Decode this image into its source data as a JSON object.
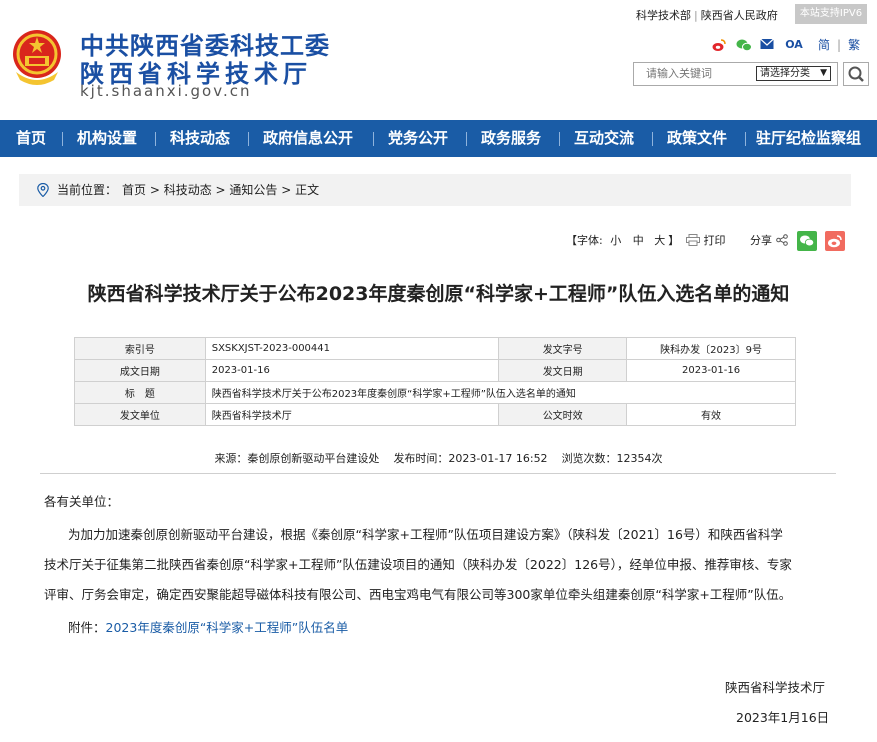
{
  "header": {
    "org_name_line1": "中共陕西省委科技工委",
    "org_name_line2": "陕西省科学技术厅",
    "domain": "kjt.shaanxi.gov.cn",
    "top_links": [
      "科学技术部",
      "陕西省人民政府"
    ],
    "ipv6_badge": "本站支持IPV6",
    "social": {
      "oa": "OA",
      "simplified": "简",
      "traditional": "繁"
    },
    "search": {
      "placeholder": "请输入关键词",
      "category_label": "请选择分类"
    }
  },
  "nav": {
    "items": [
      "首页",
      "机构设置",
      "科技动态",
      "政府信息公开",
      "党务公开",
      "政务服务",
      "互动交流",
      "政策文件",
      "驻厅纪检监察组"
    ]
  },
  "breadcrumb": {
    "label": "当前位置：",
    "path": [
      "首页",
      "科技动态",
      "通知公告",
      "正文"
    ]
  },
  "tools": {
    "font_prefix": "【字体:",
    "font_small": "小",
    "font_medium": "中",
    "font_large": "大",
    "font_suffix": "】",
    "print": "打印",
    "share": "分享"
  },
  "article": {
    "title": "陕西省科学技术厅关于公布2023年度秦创原“科学家+工程师”队伍入选名单的通知",
    "meta": {
      "index_label": "索引号",
      "index_value": "SXSKXJST-2023-000441",
      "doc_no_label": "发文字号",
      "doc_no_value": "陕科办发〔2023〕9号",
      "created_label": "成文日期",
      "created_value": "2023-01-16",
      "published_label": "发文日期",
      "published_value": "2023-01-16",
      "title_label": "标　题",
      "title_value": "陕西省科学技术厅关于公布2023年度秦创原“科学家+工程师”队伍入选名单的通知",
      "issuer_label": "发文单位",
      "issuer_value": "陕西省科学技术厅",
      "validity_label": "公文时效",
      "validity_value": "有效"
    },
    "source": "来源：秦创原创新驱动平台建设处",
    "publish_time": "发布时间：2023-01-17 16:52",
    "views": "浏览次数：12354次",
    "salutation": "各有关单位：",
    "para_lines": [
      "为加力加速秦创原创新驱动平台建设，根据《秦创原“科学家+工程师”队伍项目建设方案》（陕科发〔2021〕16号）和陕西省科学",
      "技术厅关于征集第二批陕西省秦创原“科学家+工程师”队伍建设项目的通知（陕科办发〔2022〕126号），经单位申报、推荐审核、专家",
      "评审、厅务会审定，确定西安聚能超导磁体科技有限公司、西电宝鸡电气有限公司等300家单位牵头组建秦创原“科学家+工程师”队伍。"
    ],
    "attachment_label": "附件：",
    "attachment_link": "2023年度秦创原“科学家+工程师”队伍名单",
    "signature_org": "陕西省科学技术厅",
    "signature_date": "2023年1月16日"
  }
}
